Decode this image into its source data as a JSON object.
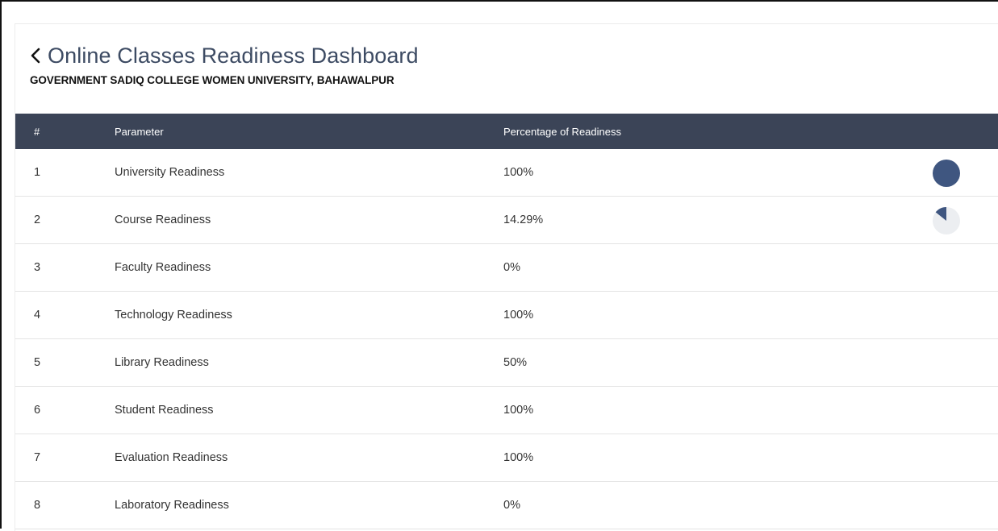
{
  "header": {
    "title": "Online Classes Readiness Dashboard",
    "subtitle": "GOVERNMENT SADIQ COLLEGE WOMEN UNIVERSITY, BAHAWALPUR",
    "back_icon": "chevron-left-icon"
  },
  "table": {
    "columns": [
      "#",
      "Parameter",
      "Percentage of Readiness"
    ],
    "rows": [
      {
        "num": "1",
        "parameter": "University Readiness",
        "percentage": "100%",
        "pie_fraction": 1.0
      },
      {
        "num": "2",
        "parameter": "Course Readiness",
        "percentage": "14.29%",
        "pie_fraction": 0.1429
      },
      {
        "num": "3",
        "parameter": "Faculty Readiness",
        "percentage": "0%"
      },
      {
        "num": "4",
        "parameter": "Technology Readiness",
        "percentage": "100%"
      },
      {
        "num": "5",
        "parameter": "Library Readiness",
        "percentage": "50%"
      },
      {
        "num": "6",
        "parameter": "Student Readiness",
        "percentage": "100%"
      },
      {
        "num": "7",
        "parameter": "Evaluation Readiness",
        "percentage": "100%"
      },
      {
        "num": "8",
        "parameter": "Laboratory Readiness",
        "percentage": "0%"
      }
    ]
  },
  "colors": {
    "header_bg": "#3b4457",
    "title": "#3d4b63",
    "pie_fill": "#3f5680",
    "pie_track": "#eceef1"
  }
}
